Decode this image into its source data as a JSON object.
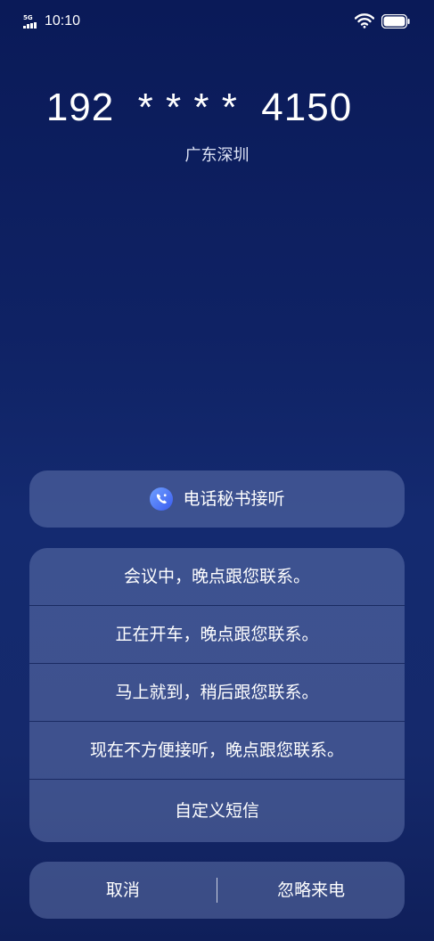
{
  "status_bar": {
    "network": "5G",
    "time": "10:10",
    "icons": [
      "signal-icon",
      "wifi-icon",
      "battery-icon"
    ]
  },
  "caller": {
    "number": "192  * * * *  4150",
    "location": "广东深圳"
  },
  "secretary": {
    "icon": "call-secretary-icon",
    "label": "电话秘书接听"
  },
  "quick_replies": [
    {
      "label": "会议中，晚点跟您联系。"
    },
    {
      "label": "正在开车，晚点跟您联系。"
    },
    {
      "label": "马上就到，稍后跟您联系。"
    },
    {
      "label": "现在不方便接听，晚点跟您联系。"
    },
    {
      "label": "自定义短信"
    }
  ],
  "actions": {
    "cancel_label": "取消",
    "ignore_label": "忽略来电"
  },
  "colors": {
    "background_top": "#0a1a58",
    "background_mid": "#142a70",
    "panel": "#5a6aa0",
    "secretary_icon": "#4a7cff"
  }
}
